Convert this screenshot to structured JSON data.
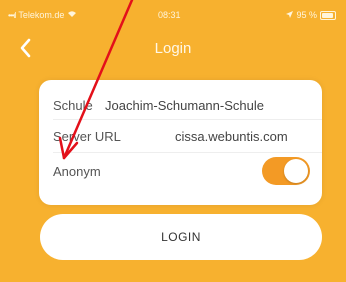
{
  "status_bar": {
    "carrier": "Telekom.de",
    "time": "08:31",
    "battery": "95 %"
  },
  "nav": {
    "title": "Login",
    "back_icon": "chevron-left-icon"
  },
  "form": {
    "school_label": "Schule",
    "school_value": "Joachim-Schumann-Schule",
    "server_label": "Server URL",
    "server_value": "cissa.webuntis.com",
    "anonymous_label": "Anonym",
    "anonymous_enabled": true
  },
  "login_button": "LOGIN",
  "colors": {
    "background": "#f7b12f",
    "toggle_on": "#f39a25",
    "annotation_arrow": "#e3101a"
  }
}
